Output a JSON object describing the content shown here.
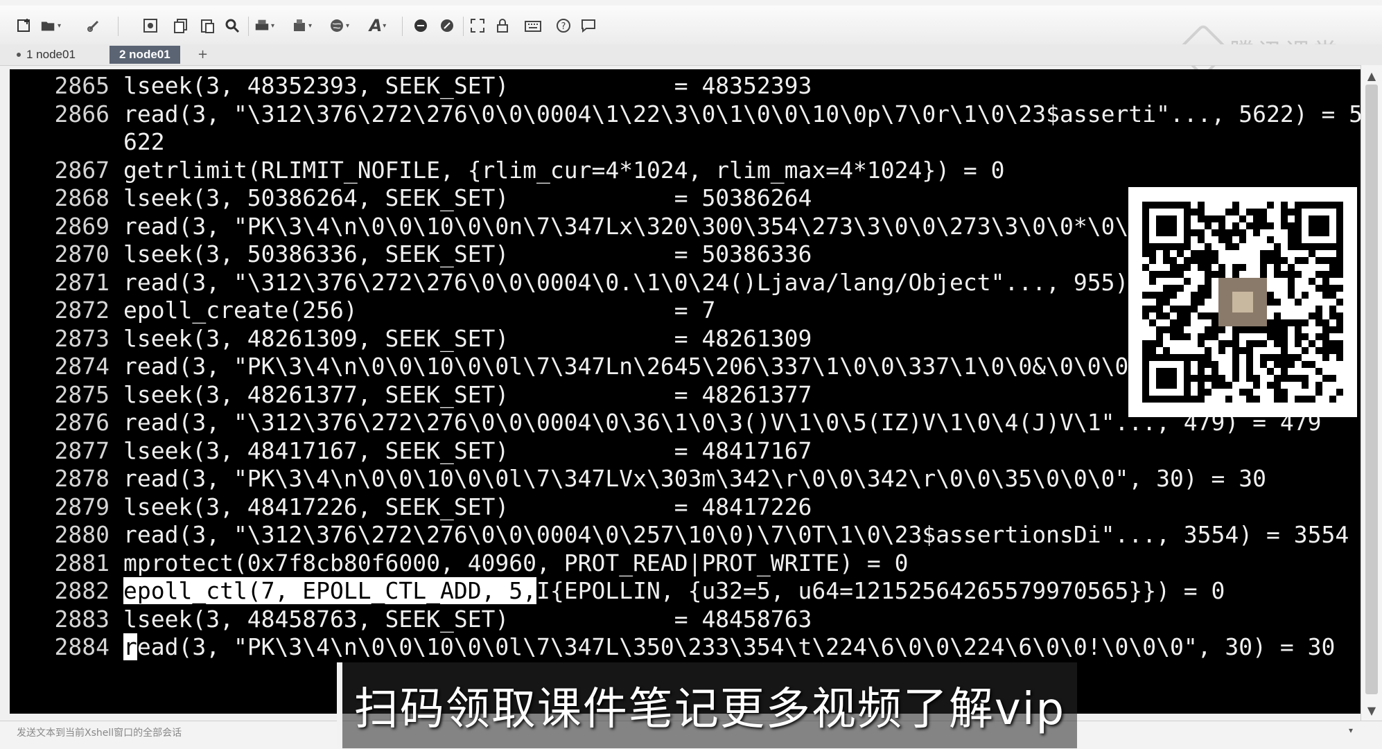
{
  "tabs": [
    {
      "label": "1 node01",
      "active": false
    },
    {
      "label": "2 node01",
      "active": true
    }
  ],
  "tab_add": "+",
  "watermark": "腾讯课堂",
  "terminal": {
    "lines": [
      {
        "num": "2865",
        "text": "lseek(3, 48352393, SEEK_SET)            = 48352393"
      },
      {
        "num": "2866",
        "text": "read(3, \"\\312\\376\\272\\276\\0\\0\\0004\\1\\22\\3\\0\\1\\0\\0\\10\\0p\\7\\0r\\1\\0\\23$asserti\"..., 5622) = 5"
      },
      {
        "num": "",
        "text": "622"
      },
      {
        "num": "2867",
        "text": "getrlimit(RLIMIT_NOFILE, {rlim_cur=4*1024, rlim_max=4*1024}) = 0"
      },
      {
        "num": "2868",
        "text": "lseek(3, 50386264, SEEK_SET)            = 50386264"
      },
      {
        "num": "2869",
        "text": "read(3, \"PK\\3\\4\\n\\0\\0\\10\\0\\0n\\7\\347Lx\\320\\300\\354\\273\\3\\0\\0\\273\\3\\0\\0*\\0\\0"
      },
      {
        "num": "2870",
        "text": "lseek(3, 50386336, SEEK_SET)            = 50386336"
      },
      {
        "num": "2871",
        "text": "read(3, \"\\312\\376\\272\\276\\0\\0\\0004\\0.\\1\\0\\24()Ljava/lang/Object\"..., 955)"
      },
      {
        "num": "2872",
        "text": "epoll_create(256)                       = 7"
      },
      {
        "num": "2873",
        "text": "lseek(3, 48261309, SEEK_SET)            = 48261309"
      },
      {
        "num": "2874",
        "text": "read(3, \"PK\\3\\4\\n\\0\\0\\10\\0\\0l\\7\\347Ln\\2645\\206\\337\\1\\0\\0\\337\\1\\0\\0&\\0\\0\\0\""
      },
      {
        "num": "2875",
        "text": "lseek(3, 48261377, SEEK_SET)            = 48261377"
      },
      {
        "num": "2876",
        "text": "read(3, \"\\312\\376\\272\\276\\0\\0\\0004\\0\\36\\1\\0\\3()V\\1\\0\\5(IZ)V\\1\\0\\4(J)V\\1\"..., 479) = 479"
      },
      {
        "num": "2877",
        "text": "lseek(3, 48417167, SEEK_SET)            = 48417167"
      },
      {
        "num": "2878",
        "text": "read(3, \"PK\\3\\4\\n\\0\\0\\10\\0\\0l\\7\\347LVx\\303m\\342\\r\\0\\0\\342\\r\\0\\0\\35\\0\\0\\0\", 30) = 30"
      },
      {
        "num": "2879",
        "text": "lseek(3, 48417226, SEEK_SET)            = 48417226"
      },
      {
        "num": "2880",
        "text": "read(3, \"\\312\\376\\272\\276\\0\\0\\0004\\0\\257\\10\\0)\\7\\0T\\1\\0\\23$assertionsDi\"..., 3554) = 3554"
      },
      {
        "num": "2881",
        "text": "mprotect(0x7f8cb80f6000, 40960, PROT_READ|PROT_WRITE) = 0"
      },
      {
        "num": "2882",
        "text_hl": "epoll_ctl(7, EPOLL_CTL_ADD, 5,",
        "text_rest": "I{EPOLLIN, {u32=5, u64=12152564265579970565}}) = 0"
      },
      {
        "num": "2883",
        "text": "lseek(3, 48458763, SEEK_SET)            = 48458763"
      },
      {
        "num": "2884",
        "text_cursor": "r",
        "text_rest": "ead(3, \"PK\\3\\4\\n\\0\\0\\10\\0\\0l\\7\\347L\\350\\233\\354\\t\\224\\6\\0\\0\\224\\6\\0\\0!\\0\\0\\0\", 30) = 30"
      }
    ]
  },
  "send_text": "发送文本到当前Xshell窗口的全部会话",
  "caption": "扫码领取课件笔记更多视频了解vip",
  "scroll": {
    "up": "▲",
    "down": "▼"
  }
}
